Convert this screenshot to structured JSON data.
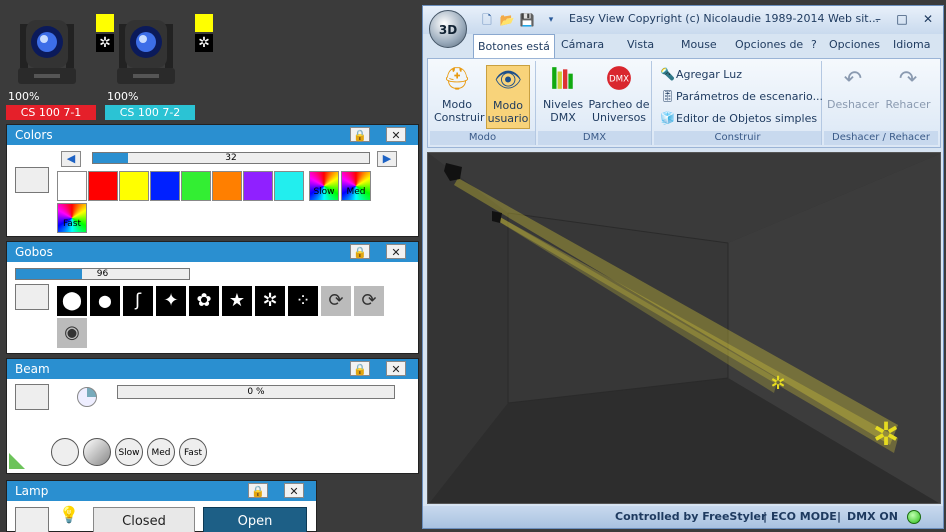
{
  "fixtures": [
    {
      "pct": "100%",
      "label": "CS 100 7-1",
      "label_color": "#e5202a",
      "swatch_color": "#ffff00",
      "gobo_icon": "spiral-gobo-icon"
    },
    {
      "pct": "100%",
      "label": "CS 100 7-2",
      "label_color": "#2bc3d4",
      "swatch_color": "#ffff00",
      "gobo_icon": "spiral-gobo-icon"
    }
  ],
  "colors_panel": {
    "title": "Colors",
    "slider_value": "32",
    "slider_fraction": 0.125,
    "swatches": [
      "#ffffff",
      "#ff0000",
      "#ffff00",
      "#0020ff",
      "#33ee33",
      "#ff7f00",
      "#9020ff",
      "#22eeee"
    ],
    "speed_buttons": [
      "Slow",
      "Med",
      "Fast"
    ]
  },
  "gobos_panel": {
    "title": "Gobos",
    "slider_value": "96",
    "slider_fraction": 0.38
  },
  "beam_panel": {
    "title": "Beam",
    "slider_value": "0 %",
    "speed_buttons": [
      "Slow",
      "Med",
      "Fast"
    ]
  },
  "lamp_panel": {
    "title": "Lamp",
    "closed_label": "Closed",
    "open_label": "Open"
  },
  "window": {
    "orb_label": "3D",
    "title": "Easy View   Copyright (c) Nicolaudie 1989-2014   Web sit...",
    "tabs": [
      "Botones está",
      "Cámara",
      "Vista",
      "Mouse",
      "Opciones de",
      "?",
      "Opciones",
      "Idioma"
    ],
    "groups": {
      "modo": {
        "label": "Modo",
        "buttons": [
          "Modo Construir",
          "Modo usuario"
        ]
      },
      "dmx": {
        "label": "DMX",
        "buttons": [
          "Niveles DMX",
          "Parcheo de Universos"
        ]
      },
      "construir": {
        "label": "Construir",
        "items": [
          "Agregar Luz",
          "Parámetros de escenario...",
          "Editor de Objetos simples"
        ]
      },
      "undo": {
        "label": "Deshacer / Rehacer",
        "buttons": [
          "Deshacer",
          "Rehacer"
        ]
      }
    },
    "status": {
      "controlled": "Controlled by FreeStyler",
      "eco": "ECO MODE",
      "dmx": "DMX ON",
      "sep": "|"
    }
  }
}
